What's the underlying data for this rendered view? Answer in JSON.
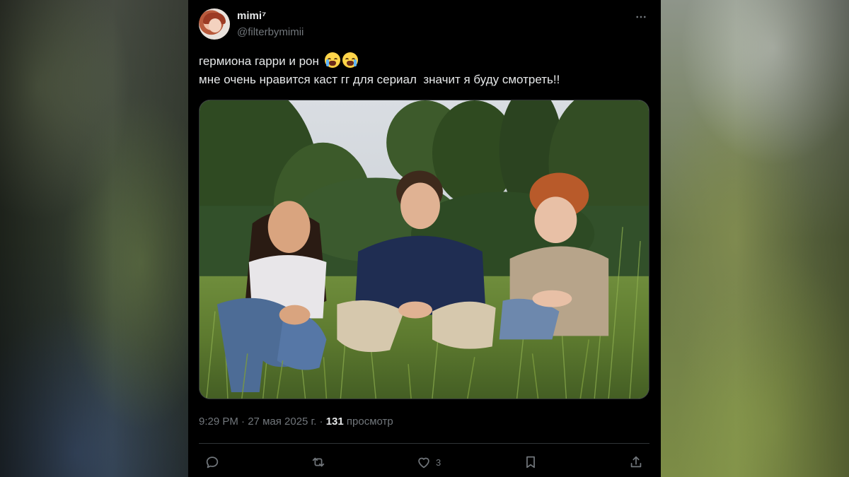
{
  "tweet": {
    "display_name": "mimi⁷",
    "handle": "@filterbymimii",
    "text_line1": "гермиона гарри и рон",
    "text_line2": "мне очень нравится каст гг для сериал  значит я буду смотреть!!",
    "emoji": "loudly-crying-face",
    "time": "9:29 PM",
    "date": "27 мая 2025 г.",
    "views_count": "131",
    "views_label": "просмотр",
    "like_count": "3"
  },
  "icons": [
    "more-options-icon",
    "reply-icon",
    "retweet-icon",
    "like-icon",
    "bookmark-icon",
    "share-icon"
  ],
  "colors": {
    "background": "#000000",
    "text_primary": "#e7e9ea",
    "text_secondary": "#71767b",
    "border": "#2f3336"
  }
}
